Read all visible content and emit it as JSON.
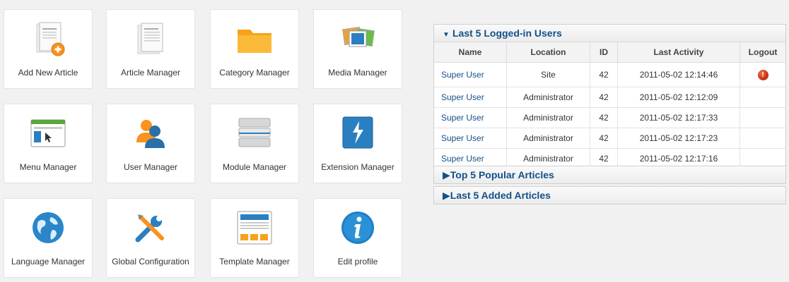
{
  "quickicons": [
    {
      "label": "Add New Article",
      "icon": "add-article-icon"
    },
    {
      "label": "Article Manager",
      "icon": "article-icon"
    },
    {
      "label": "Category Manager",
      "icon": "folder-icon"
    },
    {
      "label": "Media Manager",
      "icon": "media-icon"
    },
    {
      "label": "Menu Manager",
      "icon": "menu-icon"
    },
    {
      "label": "User Manager",
      "icon": "users-icon"
    },
    {
      "label": "Module Manager",
      "icon": "module-icon"
    },
    {
      "label": "Extension Manager",
      "icon": "extension-icon"
    },
    {
      "label": "Language Manager",
      "icon": "globe-icon"
    },
    {
      "label": "Global Configuration",
      "icon": "tools-icon"
    },
    {
      "label": "Template Manager",
      "icon": "template-icon"
    },
    {
      "label": "Edit profile",
      "icon": "info-icon"
    }
  ],
  "logged_users": {
    "title": "Last 5 Logged-in Users",
    "columns": [
      "Name",
      "Location",
      "ID",
      "Last Activity",
      "Logout"
    ],
    "rows": [
      {
        "name": "Super User",
        "location": "Site",
        "id": "42",
        "activity": "2011-05-02 12:14:46",
        "logout": true
      },
      {
        "name": "Super User",
        "location": "Administrator",
        "id": "42",
        "activity": "2011-05-02 12:12:09",
        "logout": false
      },
      {
        "name": "Super User",
        "location": "Administrator",
        "id": "42",
        "activity": "2011-05-02 12:17:33",
        "logout": false
      },
      {
        "name": "Super User",
        "location": "Administrator",
        "id": "42",
        "activity": "2011-05-02 12:17:23",
        "logout": false
      },
      {
        "name": "Super User",
        "location": "Administrator",
        "id": "42",
        "activity": "2011-05-02 12:17:16",
        "logout": false
      }
    ]
  },
  "collapsed_panels": [
    {
      "title": "Top 5 Popular Articles"
    },
    {
      "title": "Last 5 Added Articles"
    }
  ],
  "colors": {
    "link": "#135089",
    "logout": "#c42b0e"
  }
}
